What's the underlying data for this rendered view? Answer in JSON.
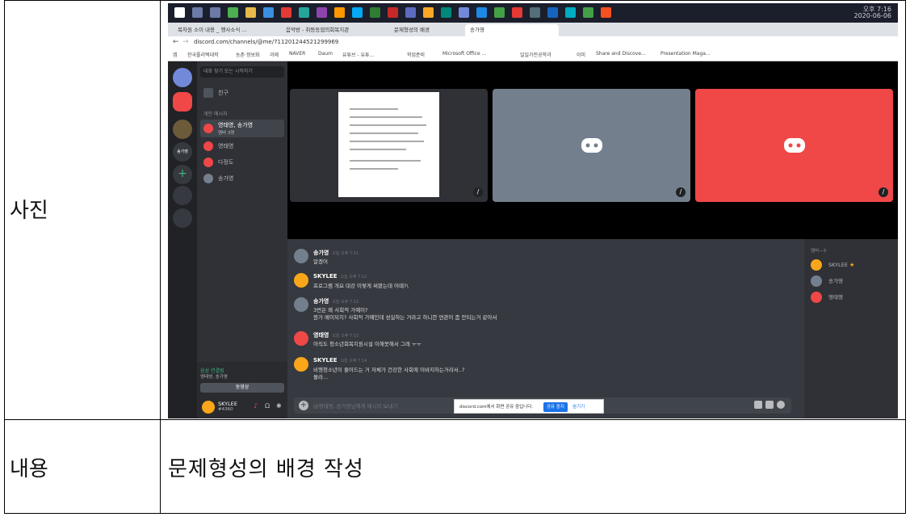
{
  "table": {
    "label_photo": "사진",
    "label_content": "내용",
    "content_text": "문제형성의 배경 작성"
  },
  "screenshot": {
    "taskbar": {
      "clock_time": "오후 7:16",
      "clock_date": "2020-06-06"
    },
    "browser": {
      "tabs": [
        {
          "label": "목차원 소이 내용 _ 행사소식 ..."
        },
        {
          "label": "음악방 - 취등동협의회복지관"
        },
        {
          "label": "문제형성의 배경"
        },
        {
          "label": "송가영"
        }
      ],
      "url": "discord.com/channels/@me/711201244521299969",
      "bookmarks": [
        "앱",
        "한국폴리텍대학",
        "농촌·정보화",
        "과제",
        "NAVER",
        "Daum",
        "유튜브 - 유튜...",
        "학업준비",
        "Microsoft Office ...",
        "일일가전공학과",
        "이미",
        "Share and Discove...",
        "Presentation Maga..."
      ]
    },
    "channels": {
      "search_placeholder": "대화 찾기 또는 시작하기",
      "friends": "친구",
      "dm_header": "개인 메시지",
      "items": [
        {
          "name": "영태영, 송가영",
          "sub": "멤버 3명"
        },
        {
          "name": "영태영"
        },
        {
          "name": "다정도"
        },
        {
          "name": "송가영"
        }
      ]
    },
    "voice": {
      "status": "음성 연결됨",
      "channel": "영태영, 송가영",
      "video_button": "동영상"
    },
    "user": {
      "name": "SKYLEE",
      "tag": "#4360"
    },
    "messages": [
      {
        "author": "송가영",
        "time": "오늘 오후 7:11",
        "lines": [
          "알겠어"
        ]
      },
      {
        "author": "SKYLEE",
        "time": "오늘 오후 7:11",
        "lines": [
          "프로그램 개요 대강 이렇게 써봤는데 어때?\\"
        ]
      },
      {
        "author": "송가영",
        "time": "오늘 오후 7:12",
        "lines": [
          "3번은 왜 사회적 가예이?",
          "뭔가 메이되지? 사회적 가예인데 성실하는 거라고 하니깐 연관이 좀 안되는거 같아서"
        ]
      },
      {
        "author": "영태영",
        "time": "오늘 오후 7:13",
        "lines": [
          "아직도 청소년회복지원시설 이해못해서 그래 ㅜㅜ"
        ]
      },
      {
        "author": "SKYLEE",
        "time": "오늘 오후 7:14",
        "lines": [
          "비행청소년이 줄어드는 거 자체가 건강한 사회에 이바지하는거라서..?",
          "몰라..."
        ]
      }
    ],
    "input_placeholder": "@영태영, 송가영님에게 메시지 보내기",
    "share_popup": {
      "text": "discord.com에서 화면 공유 중입니다.",
      "stop": "공유 중지",
      "hide": "숨기기"
    },
    "members": {
      "header": "멤버—3",
      "items": [
        {
          "name": "SKYLEE",
          "color": "#faa61a"
        },
        {
          "name": "송가영",
          "color": "#747f8d"
        },
        {
          "name": "영태영",
          "color": "#f04747"
        }
      ]
    },
    "colors": {
      "blurple": "#7289da",
      "tile_gray": "#747f8d",
      "tile_red": "#f04747",
      "online_green": "#43b581",
      "orange": "#faa61a"
    }
  }
}
